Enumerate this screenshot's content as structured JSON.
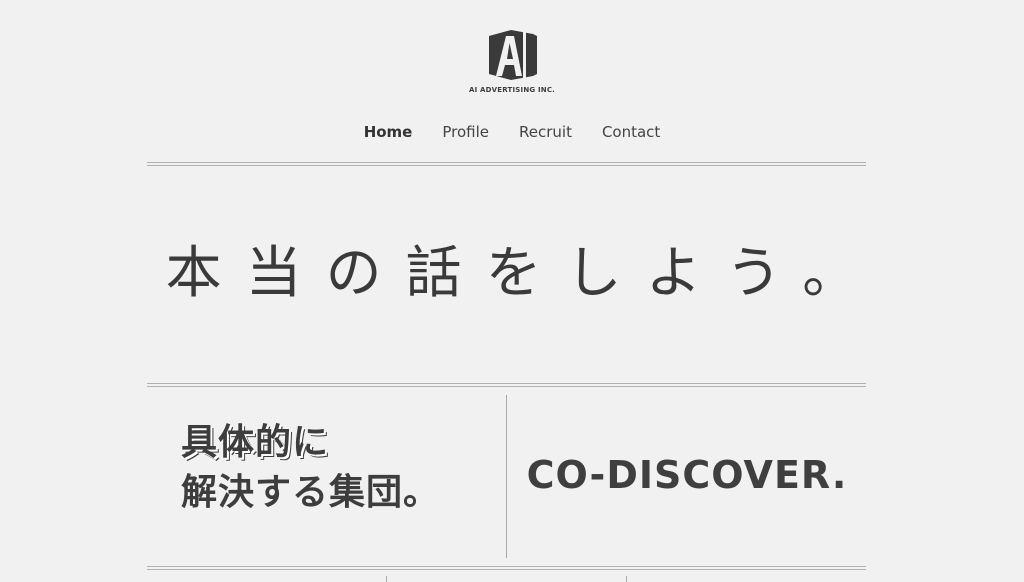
{
  "header": {
    "logo_icon": "ai-logo-mark",
    "company_name": "AI ADVERTISING INC."
  },
  "nav": {
    "items": [
      {
        "label": "Home",
        "active": true
      },
      {
        "label": "Profile",
        "active": false
      },
      {
        "label": "Recruit",
        "active": false
      },
      {
        "label": "Contact",
        "active": false
      }
    ]
  },
  "hero": {
    "tagline": "本当の話をしよう。"
  },
  "feature": {
    "left_line1": "具体的に",
    "left_line2": "解決する集団。",
    "right_text": "CO-DISCOVER."
  },
  "colors": {
    "background": "#f1f1f1",
    "text": "#3d3d3d",
    "rule": "#b0b0b0"
  }
}
